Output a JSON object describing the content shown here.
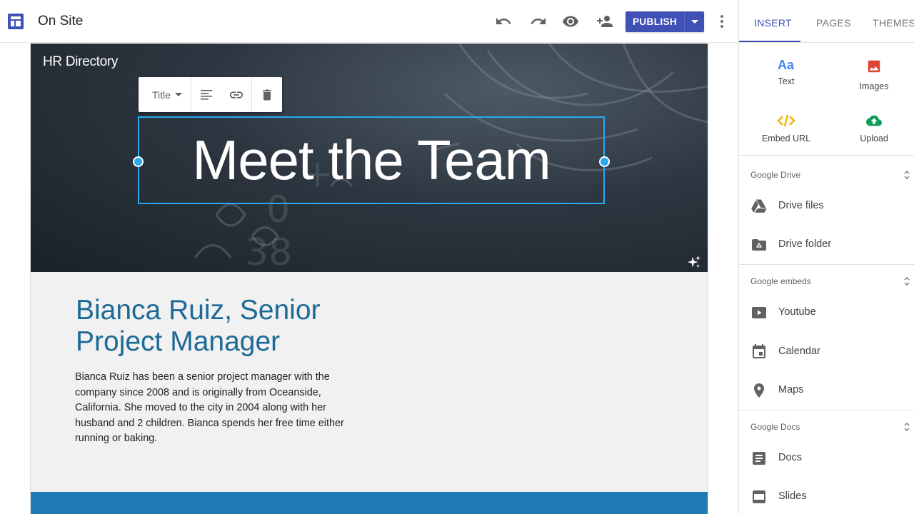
{
  "app": {
    "title": "On Site"
  },
  "toolbar": {
    "publish_label": "PUBLISH"
  },
  "banner": {
    "site_name": "HR Directory",
    "title": "Meet the Team",
    "text_style": "Title"
  },
  "content": {
    "heading": "Bianca Ruiz, Senior Project Manager",
    "body": "Bianca Ruiz has been a senior project manager with the company since 2008 and is originally from Oceanside, California.  She moved to the city in 2004 along with her husband and 2 children.  Bianca spends her free time either running or baking."
  },
  "panel": {
    "tabs": [
      "INSERT",
      "PAGES",
      "THEMES"
    ],
    "tiles": [
      {
        "label": "Text",
        "icon": "text-icon"
      },
      {
        "label": "Images",
        "icon": "image-icon"
      },
      {
        "label": "Embed URL",
        "icon": "embed-code-icon"
      },
      {
        "label": "Upload",
        "icon": "cloud-upload-icon"
      }
    ],
    "sections": [
      {
        "title": "Google Drive",
        "items": [
          {
            "label": "Drive files",
            "icon": "drive-icon"
          },
          {
            "label": "Drive folder",
            "icon": "drive-folder-icon"
          }
        ]
      },
      {
        "title": "Google embeds",
        "items": [
          {
            "label": "Youtube",
            "icon": "youtube-icon"
          },
          {
            "label": "Calendar",
            "icon": "calendar-icon"
          },
          {
            "label": "Maps",
            "icon": "map-pin-icon"
          }
        ]
      },
      {
        "title": "Google Docs",
        "items": [
          {
            "label": "Docs",
            "icon": "docs-icon"
          },
          {
            "label": "Slides",
            "icon": "slides-icon"
          }
        ]
      }
    ]
  },
  "colors": {
    "accent": "#3f51b5",
    "heading": "#1d6a96",
    "selection": "#29a9f0",
    "band": "#1f7bb4"
  }
}
